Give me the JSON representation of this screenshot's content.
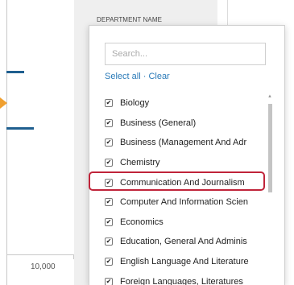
{
  "chart": {
    "axis_label": "10,000",
    "colors": {
      "mark": "#1f5f8f",
      "arrow": "#f0a030"
    }
  },
  "filter": {
    "header": "DEPARTMENT NAME",
    "search": {
      "placeholder": "Search...",
      "value": ""
    },
    "select_all": "Select all",
    "separator": "·",
    "clear": "Clear",
    "highlight_color": "#c0243a",
    "link_color": "#2a7ab8",
    "items": [
      {
        "label": "Biology",
        "checked": true
      },
      {
        "label": "Business (General)",
        "checked": true
      },
      {
        "label": "Business (Management And Adr",
        "checked": true
      },
      {
        "label": "Chemistry",
        "checked": true
      },
      {
        "label": "Communication And Journalism",
        "checked": true,
        "highlighted": true
      },
      {
        "label": "Computer And Information Scien",
        "checked": true
      },
      {
        "label": "Economics",
        "checked": true
      },
      {
        "label": "Education, General And Adminis",
        "checked": true
      },
      {
        "label": "English Language And Literature",
        "checked": true
      },
      {
        "label": "Foreign Languages, Literatures",
        "checked": true
      }
    ],
    "check_glyph": "✔"
  }
}
